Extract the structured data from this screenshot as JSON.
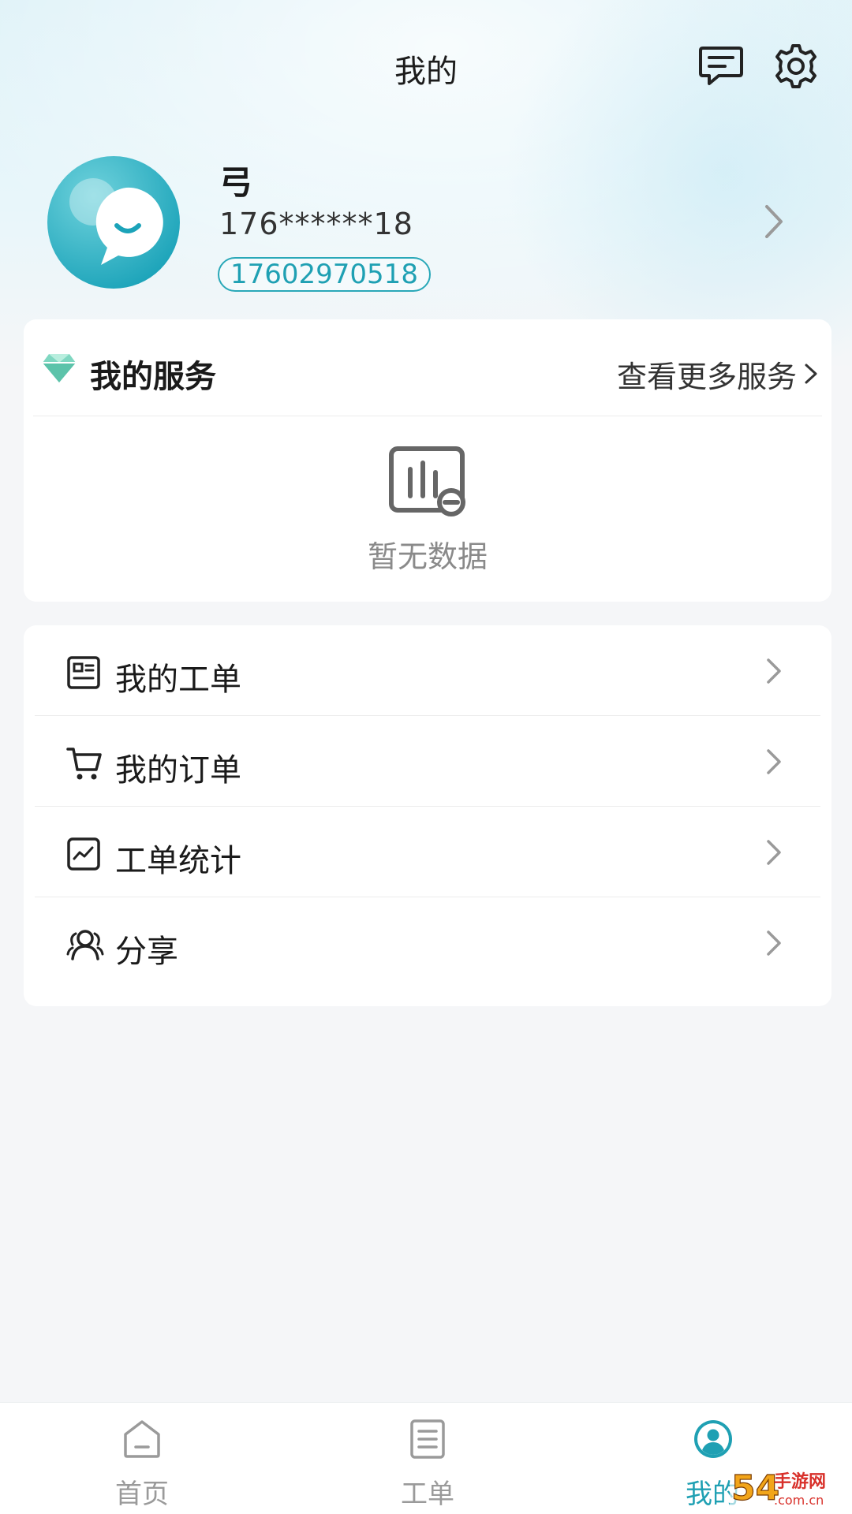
{
  "header": {
    "title": "我的"
  },
  "profile": {
    "name": "弓",
    "phone_masked": "176******18",
    "phone_tag": "17602970518"
  },
  "services": {
    "title": "我的服务",
    "more_label": "查看更多服务",
    "empty_text": "暂无数据"
  },
  "menu": {
    "items": [
      {
        "label": "我的工单",
        "icon": "work-order-icon"
      },
      {
        "label": "我的订单",
        "icon": "cart-icon"
      },
      {
        "label": "工单统计",
        "icon": "chart-icon"
      },
      {
        "label": "分享",
        "icon": "share-users-icon"
      }
    ]
  },
  "bottom_nav": {
    "items": [
      {
        "label": "首页",
        "icon": "home-icon",
        "active": false
      },
      {
        "label": "工单",
        "icon": "document-list-icon",
        "active": false
      },
      {
        "label": "我的",
        "icon": "profile-icon",
        "active": true
      }
    ]
  },
  "watermark": {
    "text": "54手游网",
    "sub": ".com.cn"
  },
  "colors": {
    "accent": "#1fa0b3",
    "avatar": "#1ba3b9",
    "inactive_nav": "#9a9a9a"
  }
}
